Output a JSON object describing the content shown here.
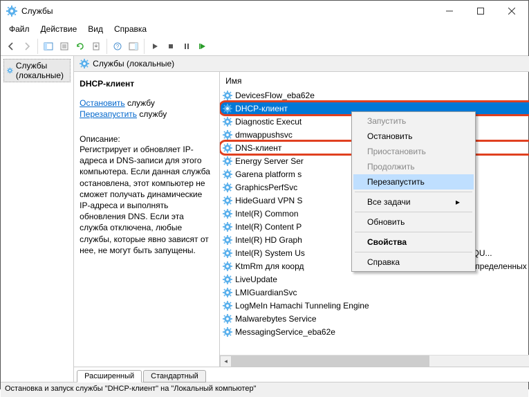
{
  "window": {
    "title": "Службы"
  },
  "menus": {
    "file": "Файл",
    "action": "Действие",
    "view": "Вид",
    "help": "Справка"
  },
  "tree": {
    "root": "Службы (локальные)"
  },
  "header": {
    "title": "Службы (локальные)"
  },
  "detail": {
    "service_name": "DHCP-клиент",
    "stop_link": "Остановить",
    "stop_suffix": " службу",
    "restart_link": "Перезапустить",
    "restart_suffix": " службу",
    "desc_label": "Описание:",
    "desc": "Регистрирует и обновляет IP-адреса и DNS-записи для этого компьютера. Если данная служба остановлена, этот компьютер не сможет получать динамические IP-адреса и выполнять обновления DNS. Если эта служба отключена, любые службы, которые явно зависят от нее, не могут быть запущены."
  },
  "list": {
    "column": "Имя",
    "items": [
      {
        "name": "DevicesFlow_eba62e"
      },
      {
        "name": "DHCP-клиент",
        "selected": true,
        "highlight": true
      },
      {
        "name": "Diagnostic Execut"
      },
      {
        "name": "dmwappushsvc"
      },
      {
        "name": "DNS-клиент",
        "highlight": true
      },
      {
        "name": "Energy Server Ser"
      },
      {
        "name": "Garena platform s"
      },
      {
        "name": "GraphicsPerfSvc"
      },
      {
        "name": "HideGuard VPN S"
      },
      {
        "name": "Intel(R) Common"
      },
      {
        "name": "Intel(R) Content P"
      },
      {
        "name": "Intel(R) HD Graph"
      },
      {
        "name": "Intel(R) System Us",
        "suffix": "ReportSvc_QU..."
      },
      {
        "name": "KtmRm для коорд",
        "suffix": "инатора распределенных транзакций"
      },
      {
        "name": "LiveUpdate"
      },
      {
        "name": "LMIGuardianSvc"
      },
      {
        "name": "LogMeIn Hamachi Tunneling Engine"
      },
      {
        "name": "Malwarebytes Service"
      },
      {
        "name": "MessagingService_eba62e"
      }
    ]
  },
  "context": {
    "start": "Запустить",
    "stop": "Остановить",
    "pause": "Приостановить",
    "resume": "Продолжить",
    "restart": "Перезапустить",
    "all_tasks": "Все задачи",
    "refresh": "Обновить",
    "properties": "Свойства",
    "help": "Справка"
  },
  "tabs": {
    "extended": "Расширенный",
    "standard": "Стандартный"
  },
  "status": "Остановка и запуск службы \"DHCP-клиент\" на \"Локальный компьютер\""
}
